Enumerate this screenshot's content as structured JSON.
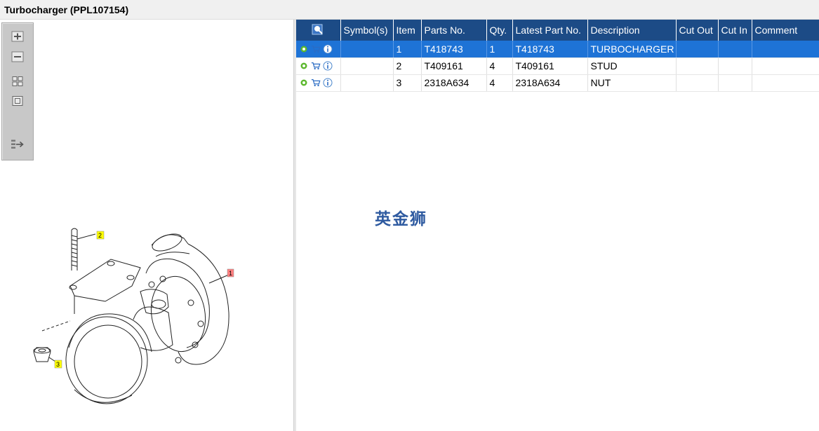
{
  "window": {
    "title": "Turbocharger (PPL107154)"
  },
  "toolbar": {
    "buttons": [
      {
        "name": "zoom-in",
        "icon": "zoom-in-icon"
      },
      {
        "name": "zoom-out",
        "icon": "zoom-out-icon"
      },
      {
        "name": "fit-all",
        "icon": "fit-all-icon"
      },
      {
        "name": "actual-size",
        "icon": "actual-size-icon"
      },
      {
        "name": "export",
        "icon": "export-icon"
      }
    ]
  },
  "drawing": {
    "callouts": [
      {
        "label": "2",
        "color": "#ffff00"
      },
      {
        "label": "1",
        "color": "#ff8080"
      },
      {
        "label": "3",
        "color": "#ffff00"
      }
    ]
  },
  "table": {
    "columns": [
      "",
      "Symbol(s)",
      "Item",
      "Parts No.",
      "Qty.",
      "Latest Part No.",
      "Description",
      "Cut Out",
      "Cut In",
      "Comment"
    ],
    "rows": [
      {
        "symbols": "",
        "item": "1",
        "part_no": "T418743",
        "qty": "1",
        "latest_part_no": "T418743",
        "description": "TURBOCHARGER",
        "cut_out": "",
        "cut_in": "",
        "comment": "",
        "selected": true
      },
      {
        "symbols": "",
        "item": "2",
        "part_no": "T409161",
        "qty": "4",
        "latest_part_no": "T409161",
        "description": "STUD",
        "cut_out": "",
        "cut_in": "",
        "comment": "",
        "selected": false
      },
      {
        "symbols": "",
        "item": "3",
        "part_no": "2318A634",
        "qty": "4",
        "latest_part_no": "2318A634",
        "description": "NUT",
        "cut_out": "",
        "cut_in": "",
        "comment": "",
        "selected": false
      }
    ]
  },
  "watermark": "英金狮",
  "colors": {
    "header": "#1c4b86",
    "selected_row": "#1e73d6",
    "toolbar": "#c8c8c8"
  }
}
